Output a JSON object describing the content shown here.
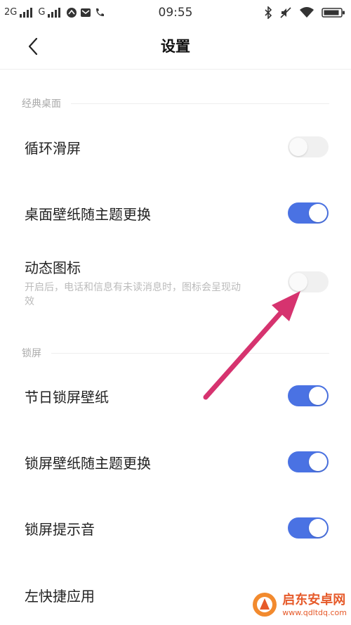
{
  "status_bar": {
    "network_1": "2G",
    "network_2": "G",
    "time": "09:55"
  },
  "header": {
    "title": "设置"
  },
  "sections": {
    "classic_desktop": {
      "label": "经典桌面"
    },
    "lock_screen": {
      "label": "锁屏"
    }
  },
  "settings": {
    "loop_scroll": {
      "label": "循环滑屏",
      "enabled": false
    },
    "wallpaper_theme": {
      "label": "桌面壁纸随主题更换",
      "enabled": true
    },
    "dynamic_icons": {
      "label": "动态图标",
      "description": "开启后，电话和信息有未读消息时，图标会呈现动效",
      "enabled": false
    },
    "holiday_lock_wallpaper": {
      "label": "节日锁屏壁纸",
      "enabled": true
    },
    "lock_wallpaper_theme": {
      "label": "锁屏壁纸随主题更换",
      "enabled": true
    },
    "lock_sound": {
      "label": "锁屏提示音",
      "enabled": true
    },
    "left_shortcut_app": {
      "label": "左快捷应用"
    }
  },
  "watermark": {
    "name": "启东安卓网",
    "url": "www.qdltdq.com"
  },
  "colors": {
    "accent": "#4a72e3",
    "toggle_off": "#f0f0f0",
    "annotation_arrow": "#d6336f",
    "watermark": "#e65a2a"
  },
  "icons": [
    "signal-icon",
    "messenger-icon",
    "mail-icon",
    "phone-icon",
    "bluetooth-icon",
    "mute-icon",
    "wifi-icon",
    "battery-icon",
    "back-icon",
    "arrow-annotation"
  ]
}
